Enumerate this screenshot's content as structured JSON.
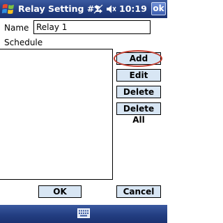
{
  "titlebar": {
    "title": "Relay Setting #1",
    "clock": "10:19",
    "ok_label": "ok",
    "icons": [
      "windows-start-icon",
      "connectivity-icon",
      "volume-icon"
    ]
  },
  "form": {
    "name_label": "Name",
    "name_value": "Relay 1",
    "schedule_label": "Schedule",
    "schedule_items": []
  },
  "side_buttons": {
    "add": "Add",
    "edit": "Edit",
    "delete": "Delete",
    "delete_all": "Delete All"
  },
  "bottom_buttons": {
    "ok": "OK",
    "cancel": "Cancel"
  },
  "sip": {
    "icon": "keyboard-icon"
  },
  "colors": {
    "titlebar": "#233e82",
    "button_bg": "#d8e6f4",
    "highlight": "#c0392b"
  }
}
